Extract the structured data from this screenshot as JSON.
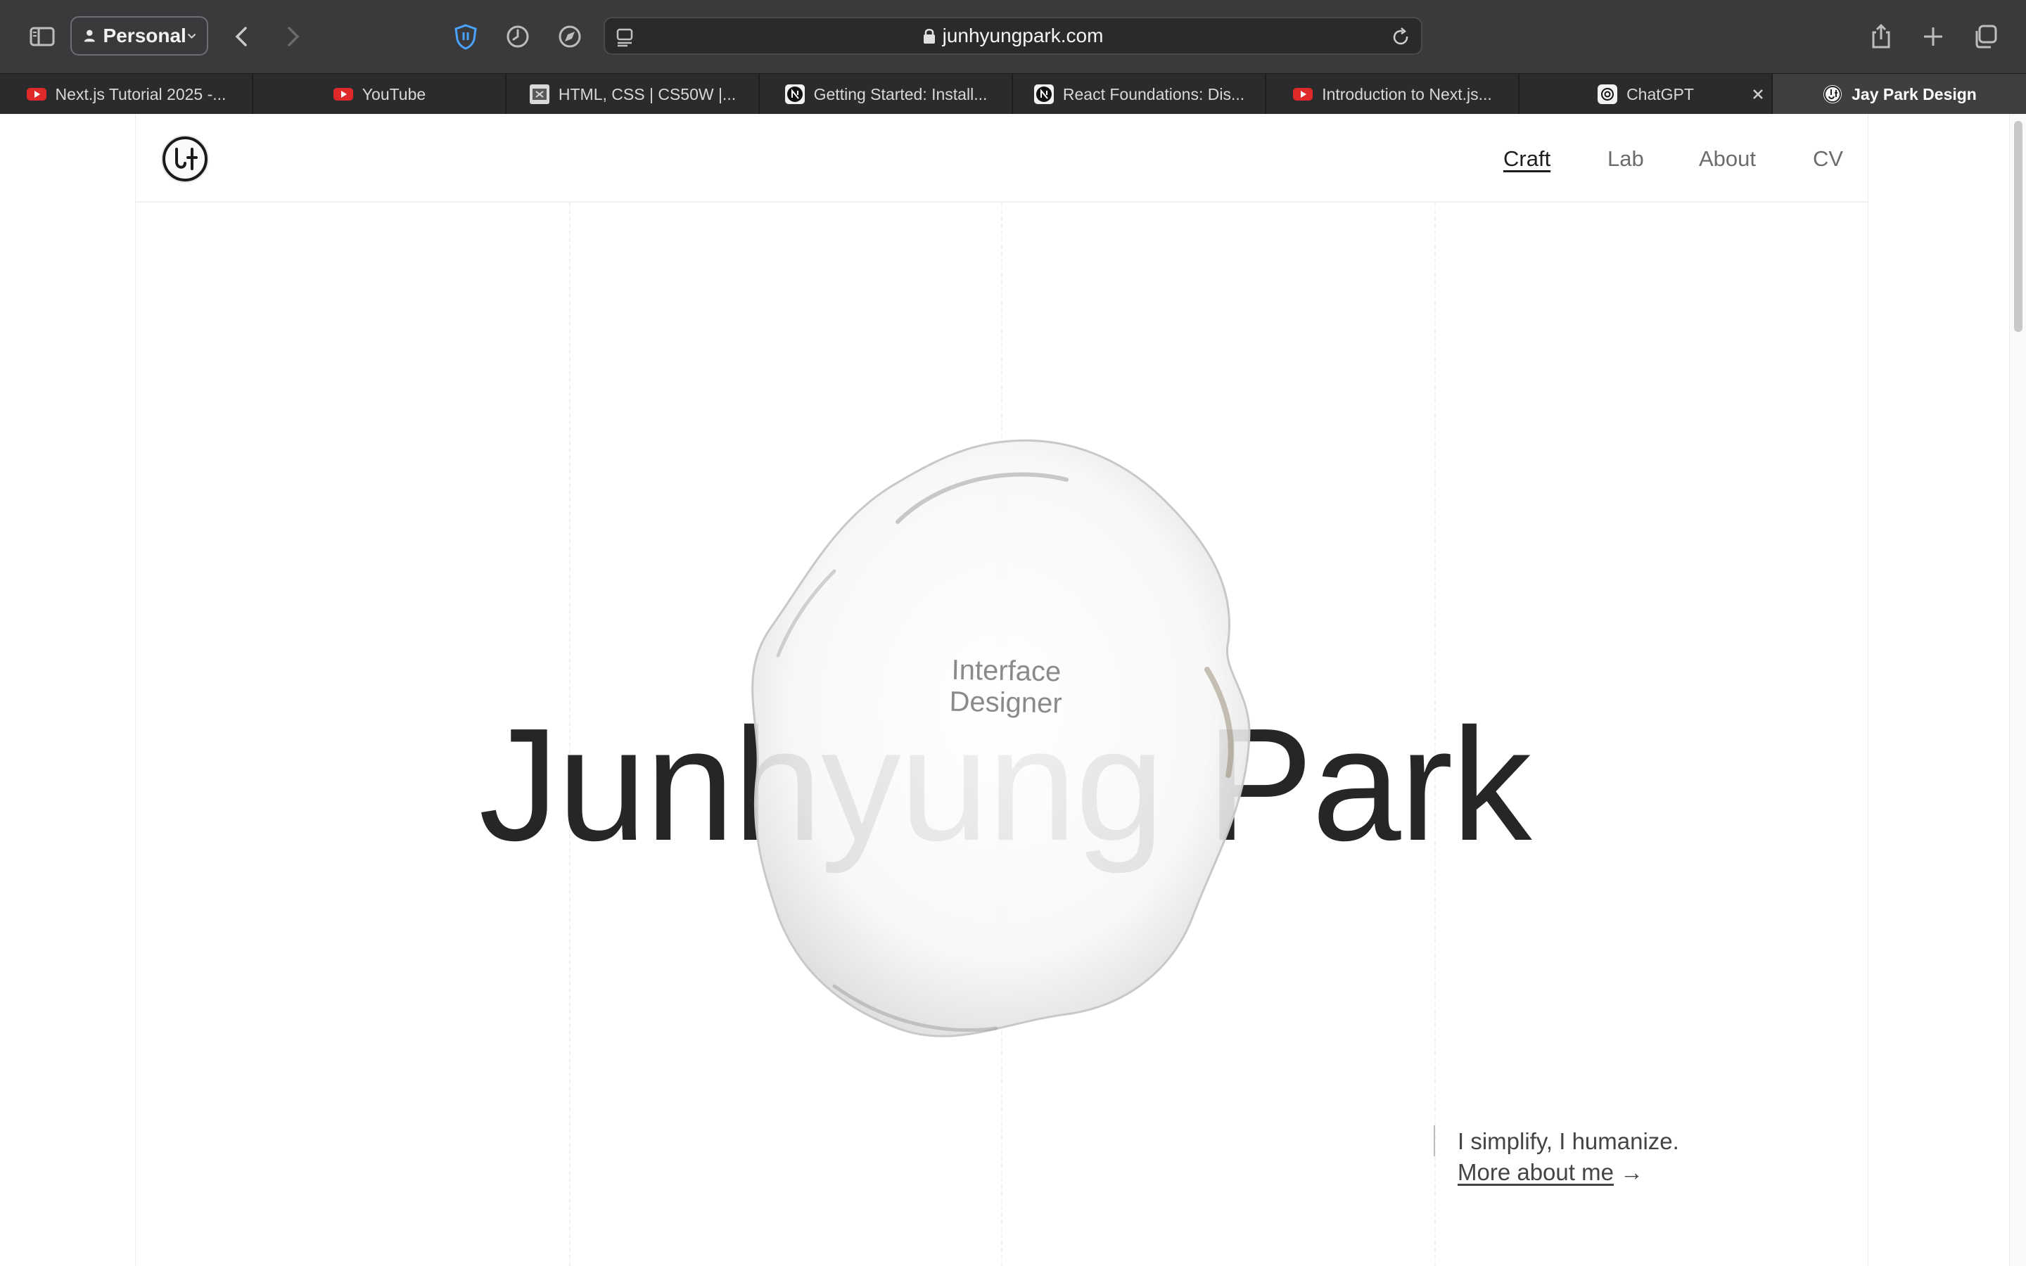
{
  "browser": {
    "profile_label": "Personal",
    "address": "junhyungpark.com",
    "icons": [
      "sidebar-icon",
      "back-icon",
      "forward-icon",
      "shield-icon",
      "history-icon",
      "compass-icon",
      "reader-icon",
      "lock-icon",
      "reload-icon",
      "share-icon",
      "new-tab-icon",
      "tab-overview-icon"
    ]
  },
  "tabs": [
    {
      "label": "Next.js Tutorial 2025 -...",
      "favicon": "youtube"
    },
    {
      "label": "YouTube",
      "favicon": "youtube"
    },
    {
      "label": "HTML, CSS | CS50W |...",
      "favicon": "cs50"
    },
    {
      "label": "Getting Started: Install...",
      "favicon": "nextjs"
    },
    {
      "label": "React Foundations: Dis...",
      "favicon": "nextjs"
    },
    {
      "label": "Introduction to Next.js...",
      "favicon": "youtube"
    },
    {
      "label": "ChatGPT",
      "favicon": "chatgpt"
    },
    {
      "label": "Jay Park Design",
      "favicon": "jaypark",
      "active": true
    }
  ],
  "site": {
    "nav": [
      "Craft",
      "Lab",
      "About",
      "CV"
    ],
    "current_nav": "Craft",
    "hero_name": "Junhyung Park",
    "hero_role": "Interface Designer",
    "tagline": "I simplify, I humanize.",
    "more_link": "More about me",
    "more_arrow": "→"
  },
  "colors": {
    "toolbar": "#3a3a3c",
    "tabbar": "#2b2b2d",
    "youtube_red": "#e02a2a",
    "text_dark": "#262626"
  }
}
